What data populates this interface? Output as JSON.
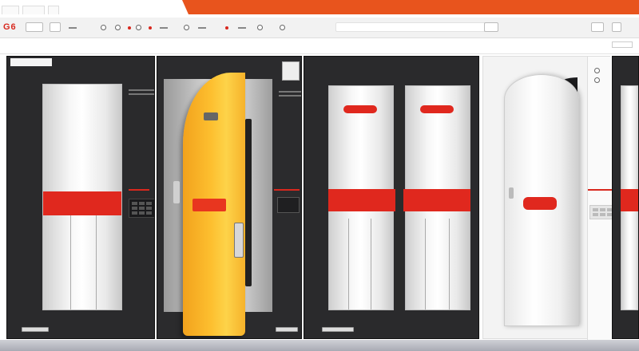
{
  "app": {
    "logo_text": "G6",
    "tabs": [
      "",
      "",
      ""
    ]
  },
  "colors": {
    "accent": "#e8541d",
    "brand_red": "#e0281e",
    "door_orange": "#fdbf2f",
    "panel_dark": "#2a2a2c"
  },
  "icons": [
    "settings-icon",
    "play-icon",
    "record-icon",
    "refresh-icon",
    "grid-icon"
  ],
  "panels": [
    {
      "name": "panel-1",
      "label": "",
      "band_text": ""
    },
    {
      "name": "panel-2",
      "label": "",
      "door_label": ""
    },
    {
      "name": "panel-3",
      "label": ""
    },
    {
      "name": "panel-4",
      "label": ""
    }
  ]
}
